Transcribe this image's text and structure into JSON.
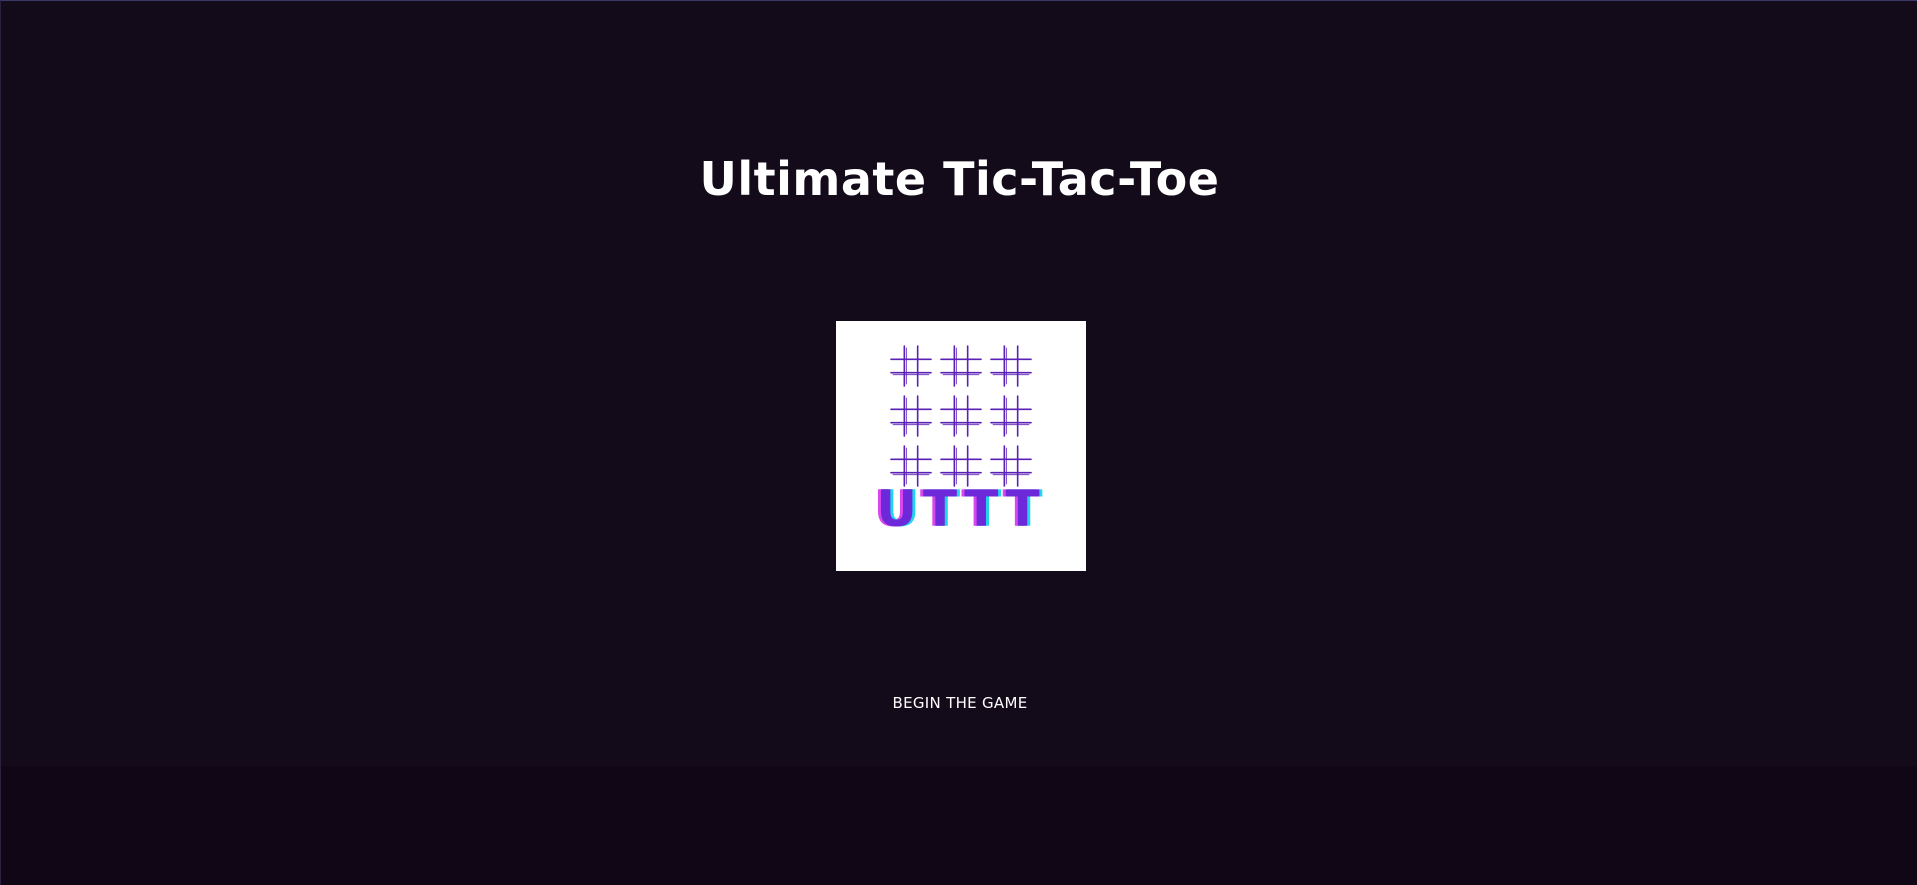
{
  "page": {
    "title": "Ultimate Tic-Tac-Toe"
  },
  "logo": {
    "text": "UTTT",
    "grid_color": "#5b21b6",
    "text_primary_color": "#6d28d9",
    "text_shadow_cyan": "#22d3ee",
    "text_shadow_magenta": "#d946ef",
    "icon": "tic-tac-toe-grid-icon"
  },
  "actions": {
    "begin_label": "BEGIN THE GAME"
  },
  "colors": {
    "background": "#130a1a",
    "text": "#ffffff"
  }
}
